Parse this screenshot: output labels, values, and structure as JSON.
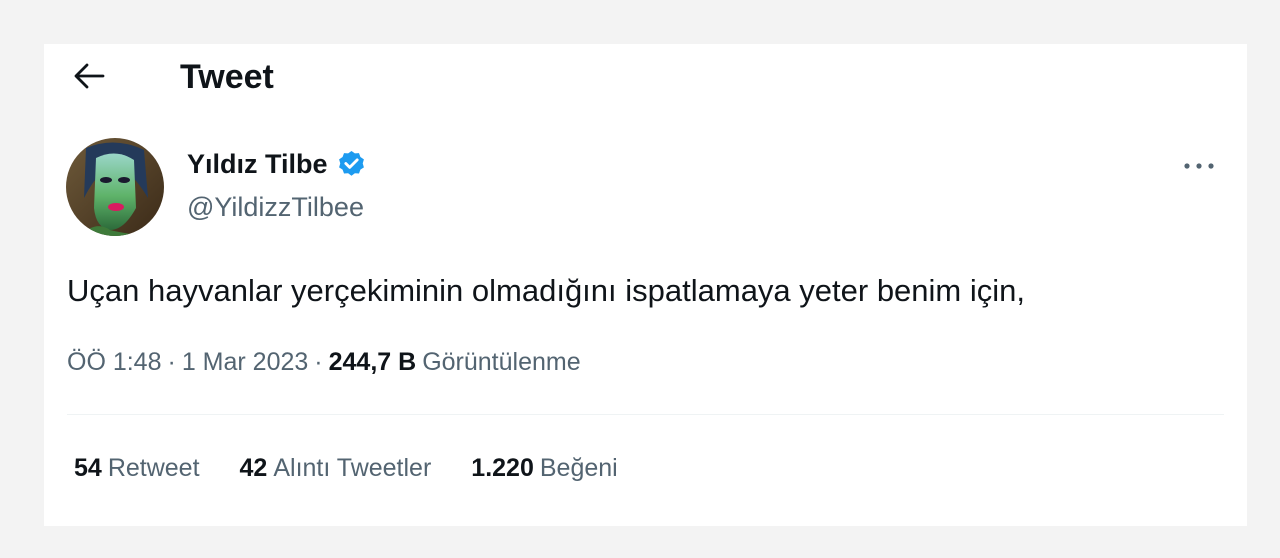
{
  "header": {
    "back_icon": "arrow-left-icon",
    "title": "Tweet"
  },
  "author": {
    "name": "Yıldız Tilbe",
    "handle": "@YildizzTilbee",
    "verified": true,
    "verified_color": "#1d9bf0",
    "avatar_icon": "profile-photo"
  },
  "tweet": {
    "text": "Uçan hayvanlar yerçekiminin olmadığını ispatlamaya yeter benim için,",
    "time": "ÖÖ 1:48",
    "separator": "·",
    "date": "1 Mar 2023",
    "views_count": "244,7 B",
    "views_label": "Görüntülenme"
  },
  "stats": [
    {
      "count": "54",
      "label": "Retweet"
    },
    {
      "count": "42",
      "label": "Alıntı Tweetler"
    },
    {
      "count": "1.220",
      "label": "Beğeni"
    }
  ],
  "more_icon": "more-horizontal-icon",
  "colors": {
    "text_primary": "#0f1419",
    "text_secondary": "#536471",
    "verified_blue": "#1d9bf0",
    "divider": "#eff3f4",
    "background": "#f3f3f3",
    "card": "#ffffff"
  }
}
